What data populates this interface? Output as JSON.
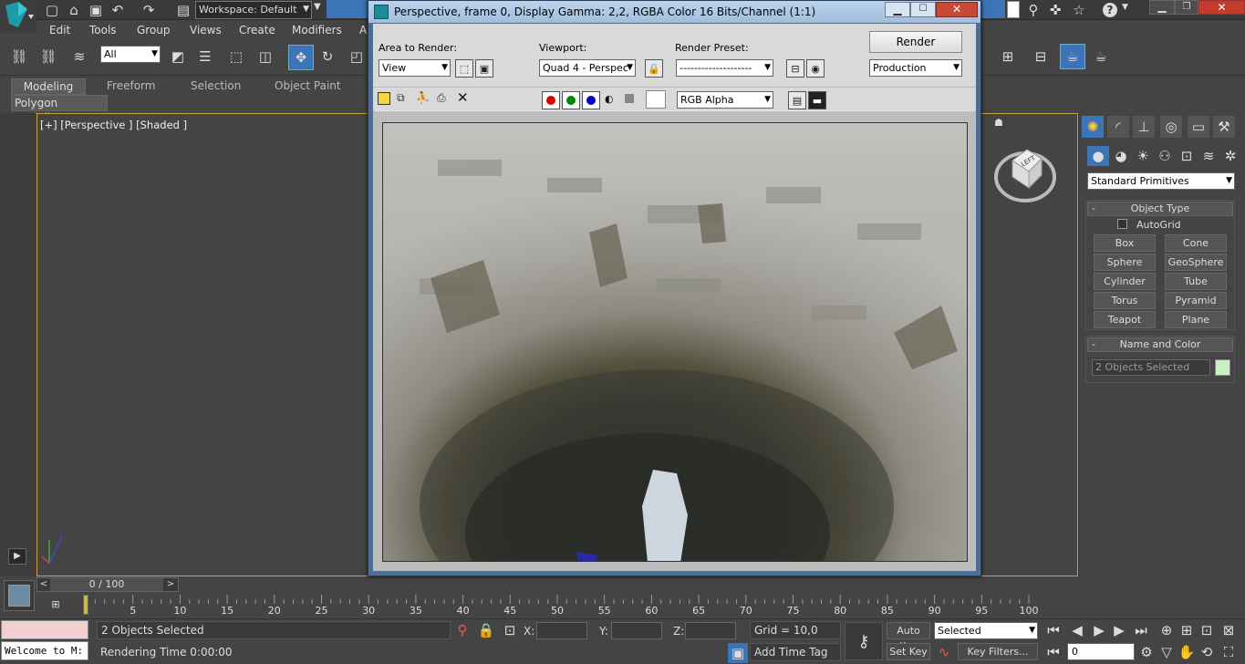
{
  "app": {
    "workspace": "Workspace: Default",
    "menu": [
      "Edit",
      "Tools",
      "Group",
      "Views",
      "Create",
      "Modifiers",
      "A"
    ],
    "selection_filter": "All",
    "ribbon_tabs": [
      "Modeling",
      "Freeform",
      "Selection",
      "Object Paint"
    ],
    "ribbon_subtab": "Polygon Modeling",
    "viewport_label": "[+] [Perspective ] [Shaded ]",
    "viewcube_label": "LEFT"
  },
  "render_window": {
    "title": "Perspective, frame 0, Display Gamma: 2,2, RGBA Color 16 Bits/Channel (1:1)",
    "area_to_render_label": "Area to Render:",
    "area_to_render_value": "View",
    "viewport_label": "Viewport:",
    "viewport_value": "Quad 4 - Perspec",
    "render_preset_label": "Render Preset:",
    "render_preset_value": "--------------------",
    "render_button": "Render",
    "production_value": "Production",
    "channel_value": "RGB Alpha"
  },
  "command_panel": {
    "category": "Standard Primitives",
    "object_type_title": "Object Type",
    "autogrid_label": "AutoGrid",
    "primitives": [
      "Box",
      "Cone",
      "Sphere",
      "GeoSphere",
      "Cylinder",
      "Tube",
      "Torus",
      "Pyramid",
      "Teapot",
      "Plane"
    ],
    "name_color_title": "Name and Color",
    "name_value": "2 Objects Selected",
    "object_color": "#c8f0c0",
    "collapse_glyph": "-"
  },
  "timeline": {
    "frame_display": "0 / 100",
    "ticks": [
      "5",
      "10",
      "15",
      "20",
      "25",
      "30",
      "35",
      "40",
      "45",
      "50",
      "55",
      "60",
      "65",
      "70",
      "75",
      "80",
      "85",
      "90",
      "95",
      "100"
    ]
  },
  "status": {
    "maxscript": "Welcome to M:",
    "selection_status": "2 Objects Selected",
    "rendering_time": "Rendering Time  0:00:00",
    "x_label": "X:",
    "y_label": "Y:",
    "z_label": "Z:",
    "grid": "Grid = 10,0",
    "add_time_tag": "Add Time Tag",
    "auto_key": "Auto Key",
    "set_key": "Set Key",
    "key_mode": "Selected",
    "key_filters": "Key Filters...",
    "current_frame": "0"
  },
  "colors": {
    "accent_blue": "#3c74b8",
    "viewport_border": "#c8a040",
    "ribbon_active": "#5a5a5a"
  }
}
